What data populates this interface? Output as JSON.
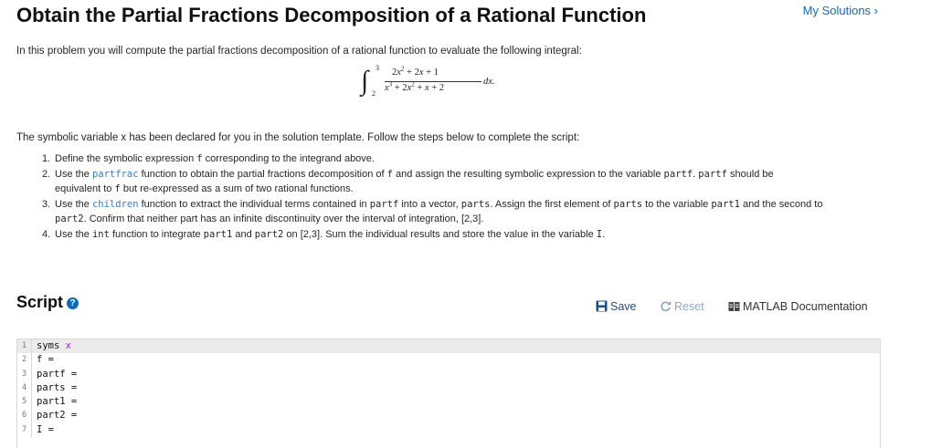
{
  "header": {
    "title": "Obtain the Partial Fractions Decomposition of a Rational Function",
    "my_solutions": "My Solutions ›"
  },
  "problem": {
    "intro": "In this problem you will  compute the partial fractions decomposition of a rational function to evaluate the following integral:",
    "integral": {
      "upper": "3",
      "lower": "2",
      "dx": "dx."
    },
    "paragraph": "The symbolic variable x has been declared for you in the solution template. Follow the steps below to complete the script:",
    "steps": [
      {
        "n": "1.",
        "parts": [
          "Define the symbolic expression ",
          "f",
          " corresponding to the integrand above."
        ]
      },
      {
        "n": "2.",
        "parts": [
          "Use the ",
          "partfrac",
          " function to obtain the partial fractions decomposition of ",
          "f",
          " and assign the resulting symbolic expression to the variable ",
          "partf",
          ". ",
          "partf",
          " should be",
          "equivalent to ",
          "f",
          " but re-expressed as a sum of two rational functions."
        ]
      },
      {
        "n": "3.",
        "parts": [
          "Use the ",
          "children",
          " function to extract the individual terms contained in ",
          "partf",
          " into a vector, ",
          "parts",
          ". Assign the first element of ",
          "parts",
          " to the variable ",
          "part1",
          " and the second to",
          "part2",
          ". Confirm that neither part has an infinite discontinuity over the interval of integration, [2,3]."
        ]
      },
      {
        "n": "4.",
        "parts": [
          "Use the ",
          "int",
          " function to integrate ",
          "part1",
          " and ",
          "part2",
          " on [2,3]. Sum the individual results and store the value in the variable ",
          "I",
          "."
        ]
      }
    ]
  },
  "script": {
    "title": "Script",
    "toolbar": {
      "save": "Save",
      "reset": "Reset",
      "doc": "MATLAB Documentation"
    },
    "lines": [
      {
        "n": "1",
        "text": "syms ",
        "kw": "x"
      },
      {
        "n": "2",
        "text": "f ="
      },
      {
        "n": "3",
        "text": "partf ="
      },
      {
        "n": "4",
        "text": "parts ="
      },
      {
        "n": "5",
        "text": "part1 ="
      },
      {
        "n": "6",
        "text": "part2 ="
      },
      {
        "n": "7",
        "text": "I ="
      }
    ]
  },
  "colors": {
    "link": "#0b6bbf",
    "code_link": "#3a7dc9",
    "keyword": "#a020f0"
  },
  "icons": {
    "help": "question-circle-icon",
    "save": "floppy-disk-icon",
    "reset": "refresh-icon",
    "doc": "book-icon"
  }
}
